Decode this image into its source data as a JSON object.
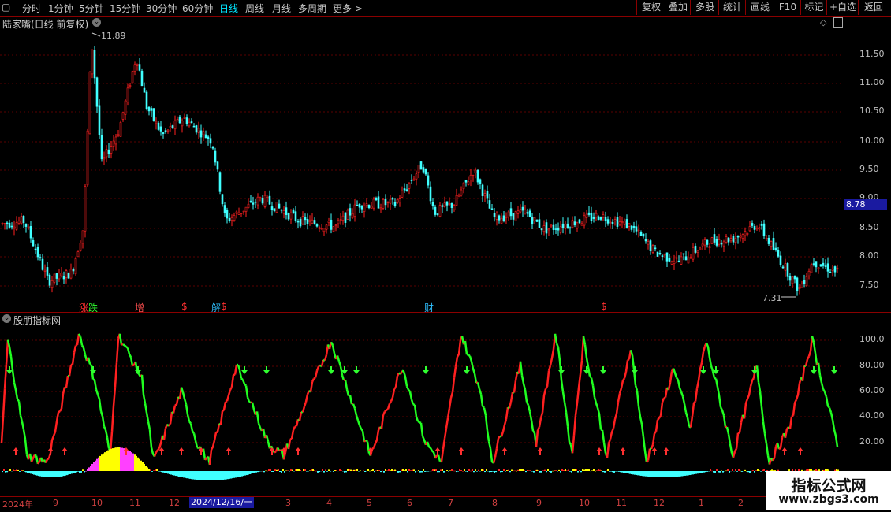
{
  "toolbar": {
    "periods": [
      "分时",
      "1分钟",
      "5分钟",
      "15分钟",
      "30分钟",
      "60分钟",
      "日线",
      "周线",
      "月线",
      "多周期",
      "更多 >"
    ],
    "active_period": "日线",
    "tools": [
      "复权",
      "叠加",
      "多股",
      "统计",
      "画线",
      "F10",
      "标记",
      "+自选",
      "返回"
    ]
  },
  "main": {
    "title": "陆家嘴(日线 前复权)",
    "high_label": "11.89",
    "low_label": "7.31",
    "current_price": "8.78",
    "price_ticks": [
      "11.50",
      "11.00",
      "10.50",
      "10.00",
      "9.50",
      "9.00",
      "8.50",
      "8.00",
      "7.50"
    ],
    "markers": [
      {
        "text": "涨",
        "color": "#ff3030"
      },
      {
        "text": "跌",
        "color": "#30ff30"
      },
      {
        "text": "增",
        "color": "#ff5050"
      },
      {
        "text": "$",
        "color": "#ff3030"
      },
      {
        "text": "解",
        "color": "#30c0ff"
      },
      {
        "text": "$",
        "color": "#ff3030"
      },
      {
        "text": "财",
        "color": "#30c0ff"
      },
      {
        "text": "$",
        "color": "#ff3030"
      }
    ]
  },
  "indicator": {
    "title": "股朋指标网",
    "ticks": [
      "100.0",
      "80.00",
      "60.00",
      "40.00",
      "20.00"
    ]
  },
  "date_axis": {
    "labels": [
      "2024年",
      "9",
      "10",
      "11",
      "12",
      "2",
      "3",
      "4",
      "5",
      "6",
      "7",
      "8",
      "9",
      "10",
      "11",
      "12",
      "1",
      "2"
    ],
    "cursor_date": "2024/12/16/一"
  },
  "watermark": {
    "line1": "指标公式网",
    "line2": "www.zbgs3.com"
  },
  "colors": {
    "up": "#ff2020",
    "down": "#40ffff",
    "grid": "#8b0000",
    "ind_up": "#ff2020",
    "ind_down": "#20ff20"
  }
}
